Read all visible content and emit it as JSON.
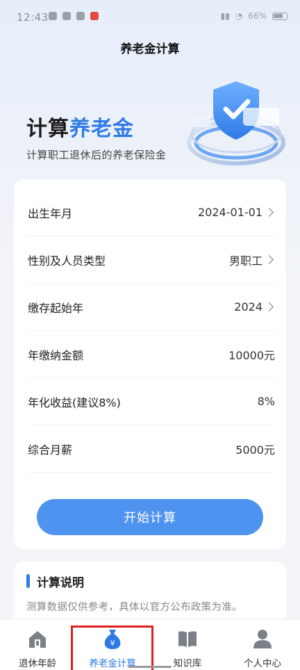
{
  "status_bar": {
    "time": "12:43",
    "battery": "66%"
  },
  "header": {
    "title": "养老金计算"
  },
  "hero": {
    "title_prefix": "计算",
    "title_accent": "养老金",
    "subtitle": "计算职工退休后的养老保险金"
  },
  "form": {
    "rows": [
      {
        "label": "出生年月",
        "value": "2024-01-01"
      },
      {
        "label": "性别及人员类型",
        "value": "男职工"
      },
      {
        "label": "缴存起始年",
        "value": "2024"
      },
      {
        "label": "年缴纳金额",
        "value": "10000元"
      },
      {
        "label": "年化收益(建议8%)",
        "value": "8%"
      },
      {
        "label": "综合月薪",
        "value": "5000元"
      }
    ],
    "start_button": "开始计算"
  },
  "notes": {
    "title": "计算说明",
    "text": "测算数据仅供参考，具体以官方公布政策为准。"
  },
  "tabbar": {
    "tabs": [
      {
        "label": "退休年龄",
        "icon": "retirement-age-icon"
      },
      {
        "label": "养老金计算",
        "icon": "money-bag-icon"
      },
      {
        "label": "知识库",
        "icon": "book-icon"
      },
      {
        "label": "个人中心",
        "icon": "person-icon"
      }
    ]
  },
  "colors": {
    "accent": "#2f7be6",
    "button": "#4f93f0",
    "highlight": "#e02020"
  }
}
